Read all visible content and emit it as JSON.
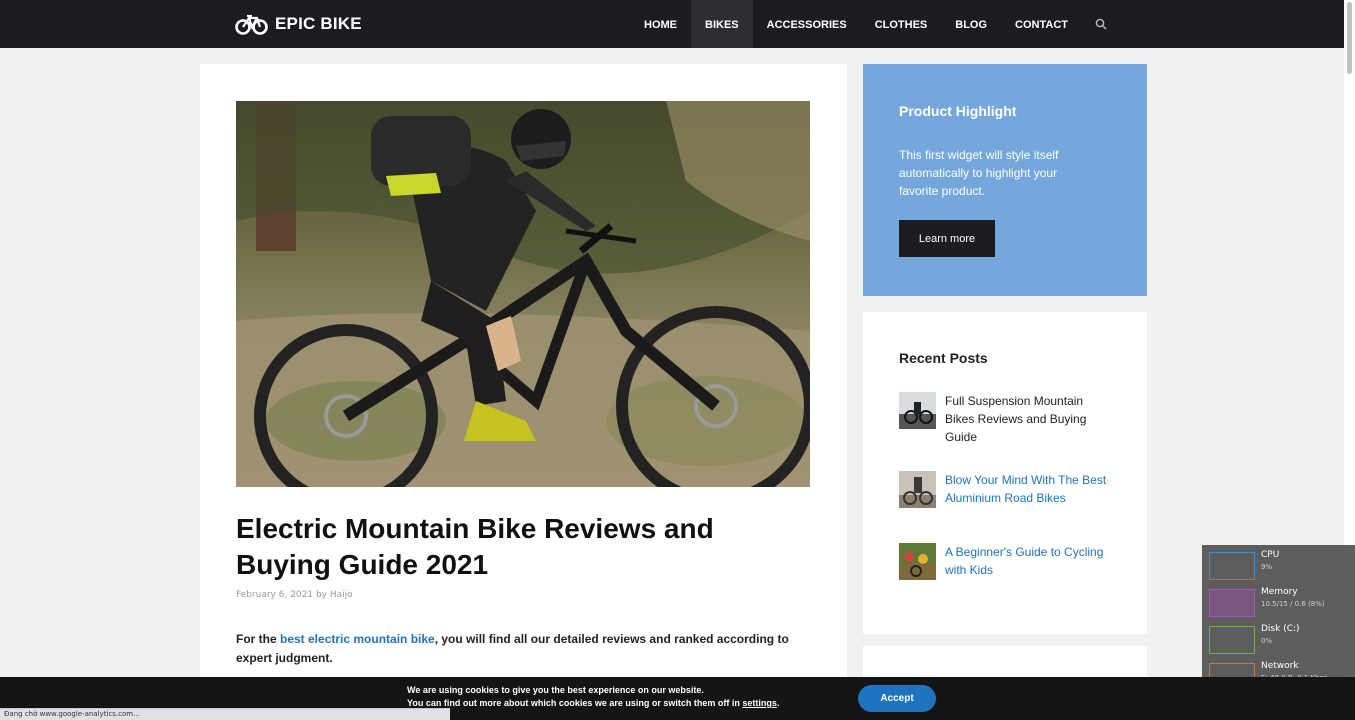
{
  "header": {
    "logo_text": "EPIC BIKE",
    "nav": [
      "HOME",
      "BIKES",
      "ACCESSORIES",
      "CLOTHES",
      "BLOG",
      "CONTACT"
    ],
    "active_nav": "BIKES",
    "search_icon": "search-icon"
  },
  "post": {
    "title": "Electric Mountain Bike Reviews and Buying Guide 2021",
    "meta": "February 6, 2021 by Haijo",
    "intro_before": "For the ",
    "intro_link": "best electric mountain bike",
    "intro_after": ", you will find all our detailed reviews and ranked according to expert judgment."
  },
  "highlight": {
    "title": "Product Highlight",
    "text": "This first widget will style itself automatically to highlight your favorite product.",
    "button": "Learn more"
  },
  "recent_posts": {
    "title": "Recent Posts",
    "items": [
      "Full Suspension Mountain Bikes Reviews and Buying Guide",
      "Blow Your Mind With The Best Aluminium Road Bikes",
      "A Beginner's Guide to Cycling with Kids"
    ]
  },
  "monitor": {
    "rows": [
      {
        "label": "CPU",
        "value": "9%",
        "color": "#3b8fd6"
      },
      {
        "label": "Memory",
        "value": "10.5/15 / 0.6 (8%)",
        "color": "#b04fc0"
      },
      {
        "label": "Disk (C:)",
        "value": "0%",
        "color": "#6ab34a"
      },
      {
        "label": "Network",
        "value": "S: 40.0 R: 8.1 Kbps",
        "color": "#c27a2e"
      }
    ]
  },
  "cookie": {
    "line1": "We are using cookies to give you the best experience on our website.",
    "line2_before": "You can find out more about which cookies we are using or switch them off in ",
    "line2_link": "settings",
    "line2_after": ".",
    "accept": "Accept"
  },
  "status_bar": "Đang chờ www.google-analytics.com..."
}
